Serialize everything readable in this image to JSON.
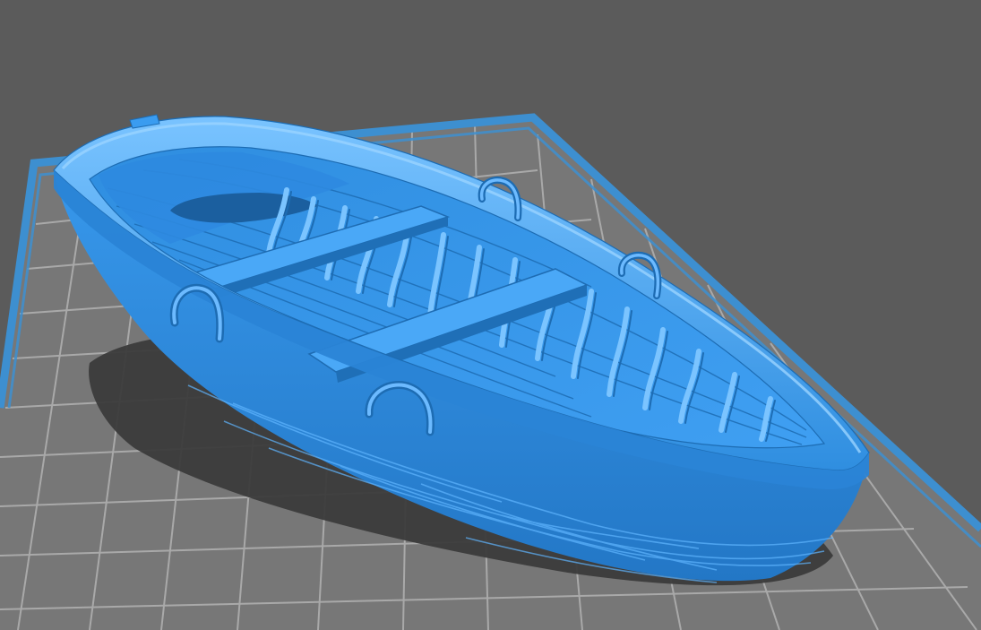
{
  "viewport": {
    "background_color": "#5b5b5b",
    "grid_line_color": "#a9a9a9",
    "plate_fill_color": "#777777",
    "plate_border_color": "#3d8fd0",
    "shadow_color": "#3b3b3b"
  },
  "model": {
    "name_icon": "rowboat-model",
    "body_color": "#2f8ee0",
    "highlight_color": "#66b7ff",
    "shade_color": "#1f6fb7",
    "dark_color": "#0f4f8c",
    "features": [
      "hull",
      "gunwale-rim",
      "benches",
      "ribs",
      "rope-loops",
      "wood-texture"
    ]
  }
}
